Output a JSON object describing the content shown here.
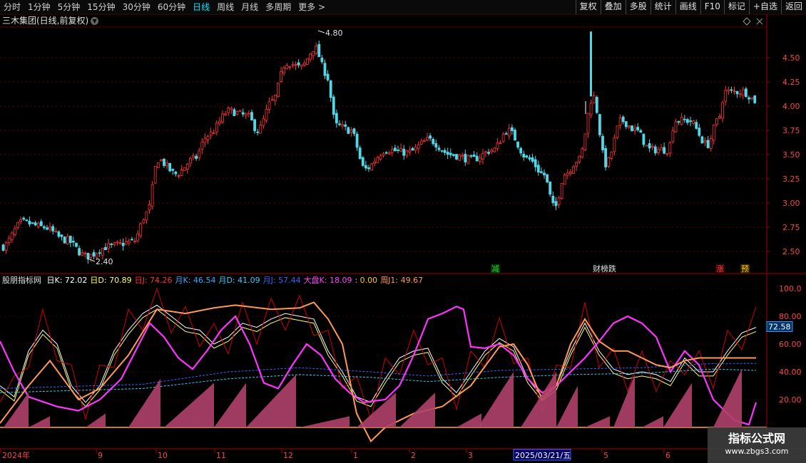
{
  "toolbar": {
    "periods": [
      "分时",
      "1分钟",
      "5分钟",
      "15分钟",
      "30分钟",
      "60分钟",
      "日线",
      "周线",
      "月线",
      "多周期",
      "更多 >"
    ],
    "active_index": 6,
    "right_buttons": [
      "复权",
      "叠加",
      "多股",
      "统计",
      "画线",
      "F10",
      "标记",
      "+自选",
      "返回"
    ]
  },
  "main": {
    "stock_title": "三木集团(日线,前复权)",
    "y_ticks": [
      "4.50",
      "4.25",
      "4.00",
      "3.75",
      "3.50",
      "3.25",
      "3.00",
      "2.75",
      "2.50"
    ],
    "high_label": "4.80",
    "low_label": "2.40",
    "signals": [
      {
        "text": "减",
        "color": "#33cc33"
      },
      {
        "text": "财榜跌",
        "color": "#e0e0e0"
      },
      {
        "text": "涨",
        "color": "#ff4444"
      },
      {
        "text": "预",
        "color": "#ffcc00"
      }
    ]
  },
  "indicator": {
    "name": "股朋指标网",
    "values": [
      {
        "label": "日K: 72.02",
        "color": "#ffffff"
      },
      {
        "label": "日D: 70.89",
        "color": "#ffff66"
      },
      {
        "label": "日J: 74.26",
        "color": "#ff3333"
      },
      {
        "label": "月K: 46.54",
        "color": "#33aaff"
      },
      {
        "label": "月D: 41.09",
        "color": "#33ccff"
      },
      {
        "label": "月J: 57.44",
        "color": "#3366ff"
      },
      {
        "label": "大盘K: 18.09",
        "color": "#ff44ff"
      },
      {
        "label": ": 0.00",
        "color": "#ffcc00"
      },
      {
        "label": "周J1: 49.67",
        "color": "#ff9955"
      }
    ],
    "y_ticks": [
      "100.0",
      "80.00",
      "60.00",
      "40.00",
      "20.00"
    ],
    "current_value": "72.58"
  },
  "xaxis": {
    "labels": [
      "2024年",
      "9",
      "10",
      "11",
      "12",
      "1",
      "2",
      "3",
      "2025/03/21/五",
      "5",
      "6"
    ]
  },
  "watermark": {
    "title": "指标公式网",
    "url": "www.zbgs3.com"
  },
  "colors": {
    "up": "#ff3333",
    "down": "#4fd9e8",
    "grid": "#660000",
    "axis": "#aa0000"
  }
}
